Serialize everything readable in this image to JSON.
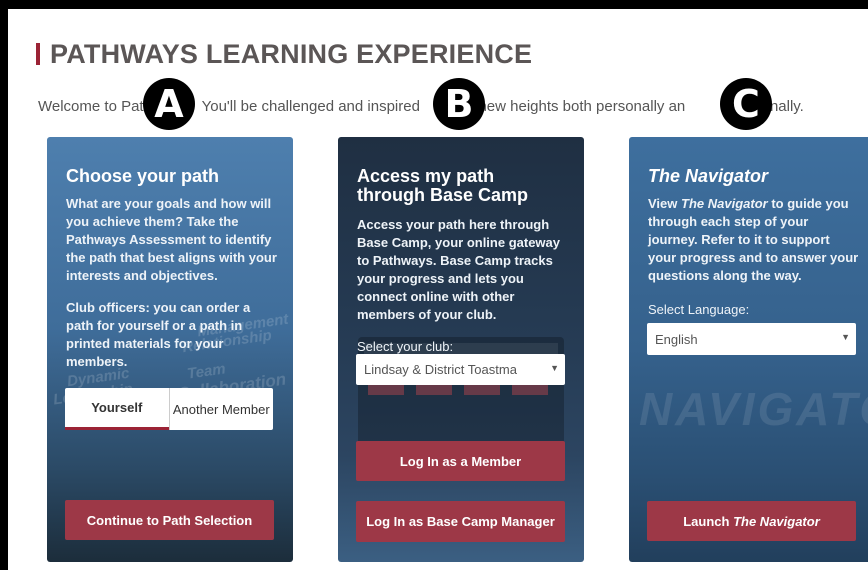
{
  "page": {
    "title": "PATHWAYS LEARNING EXPERIENCE",
    "welcome": "Welcome to Pat...You'll be challenged and inspired...h new heights both personally an...ssionally.",
    "welcome_parts": [
      "Welcome to Pat",
      "You'll be challenged and inspired",
      "h new heights both personally an",
      "ssionally."
    ]
  },
  "markers": [
    "A",
    "B",
    "C"
  ],
  "card_a": {
    "heading": "Choose your path",
    "text1": "What are your goals and how will you achieve them? Take the Pathways Assessment to identify the path that best aligns with your interests and objectives.",
    "text2": "Club officers: you can order a path for yourself or a path in printed materials for your members.",
    "toggle_options": [
      "Yourself",
      "Another Member"
    ],
    "toggle_selected": "Yourself",
    "button": "Continue to Path Selection",
    "bg_words": [
      "Dynamic",
      "Leadership",
      "Strategic",
      "Relationship",
      "Management",
      "Team",
      "Collaboration"
    ]
  },
  "card_b": {
    "heading_line1": "Access my path",
    "heading_line2": "through Base Camp",
    "text": "Access your path here through Base Camp, your online gateway to Pathways. Base Camp tracks your progress and lets you connect online with other members of your club.",
    "select_label": "Select your club:",
    "select_value": "Lindsay & District Toastma",
    "button_member": "Log In as a Member",
    "button_manager": "Log In as Base Camp Manager"
  },
  "card_c": {
    "heading": "The Navigator",
    "text_pre": "View ",
    "text_italic": "The Navigator",
    "text_post": " to guide you through each step of your journey. Refer to it to support your progress and to answer your questions along the way.",
    "select_label": "Select Language:",
    "select_value": "English",
    "watermark": "NAVIGATOR",
    "button_pre": "Launch ",
    "button_italic": "The Navigator"
  },
  "colors": {
    "accent": "#9b2335",
    "button": "#9d3847",
    "title": "#5b5656"
  },
  "icons": {
    "dropdown": "chevron-down-icon"
  }
}
